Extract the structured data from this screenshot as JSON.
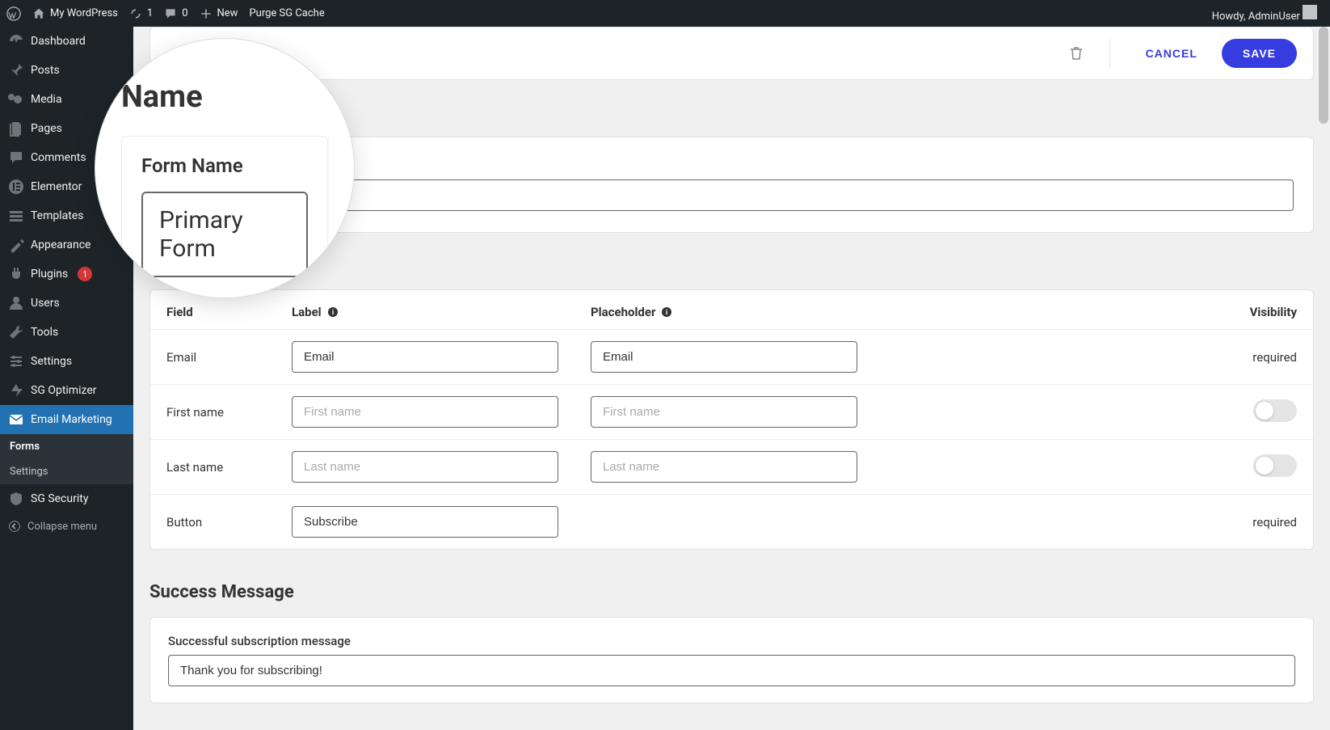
{
  "adminBar": {
    "siteName": "My WordPress",
    "updates": "1",
    "comments": "0",
    "newLabel": "New",
    "purgeLabel": "Purge SG Cache",
    "howdy": "Howdy, AdminUser"
  },
  "sidebar": {
    "items": [
      {
        "icon": "dashboard",
        "label": "Dashboard"
      },
      {
        "icon": "pin",
        "label": "Posts"
      },
      {
        "icon": "media",
        "label": "Media"
      },
      {
        "icon": "pages",
        "label": "Pages"
      },
      {
        "icon": "comments",
        "label": "Comments"
      },
      {
        "icon": "elementor",
        "label": "Elementor"
      },
      {
        "icon": "templates",
        "label": "Templates"
      },
      {
        "icon": "appearance",
        "label": "Appearance"
      },
      {
        "icon": "plugins",
        "label": "Plugins",
        "badge": "1"
      },
      {
        "icon": "users",
        "label": "Users"
      },
      {
        "icon": "tools",
        "label": "Tools"
      },
      {
        "icon": "settings",
        "label": "Settings"
      },
      {
        "icon": "sgoptimizer",
        "label": "SG Optimizer"
      },
      {
        "icon": "email",
        "label": "Email Marketing",
        "active": true
      },
      {
        "icon": "sgsecurity",
        "label": "SG Security"
      }
    ],
    "submenu": [
      {
        "label": "Forms",
        "current": true
      },
      {
        "label": "Settings",
        "current": false
      }
    ],
    "collapse": "Collapse menu"
  },
  "actions": {
    "cancel": "CANCEL",
    "save": "SAVE"
  },
  "nameCard": {
    "label": "Form Name",
    "value": "Primary Form"
  },
  "lens": {
    "title": "Name",
    "label": "Form Name",
    "value": "Primary Form"
  },
  "fieldsTable": {
    "headers": {
      "field": "Field",
      "label": "Label",
      "placeholder": "Placeholder",
      "visibility": "Visibility"
    },
    "rows": [
      {
        "field": "Email",
        "labelValue": "Email",
        "labelPlaceholder": "",
        "phValue": "Email",
        "phPlaceholder": "",
        "visType": "text",
        "visText": "required"
      },
      {
        "field": "First name",
        "labelValue": "",
        "labelPlaceholder": "First name",
        "phValue": "",
        "phPlaceholder": "First name",
        "visType": "toggle",
        "toggleOn": false
      },
      {
        "field": "Last name",
        "labelValue": "",
        "labelPlaceholder": "Last name",
        "phValue": "",
        "phPlaceholder": "Last name",
        "visType": "toggle",
        "toggleOn": false
      },
      {
        "field": "Button",
        "labelValue": "Subscribe",
        "labelPlaceholder": "",
        "phValue": null,
        "phPlaceholder": null,
        "visType": "text",
        "visText": "required"
      }
    ]
  },
  "success": {
    "title": "Success Message",
    "label": "Successful subscription message",
    "value": "Thank you for subscribing!"
  }
}
